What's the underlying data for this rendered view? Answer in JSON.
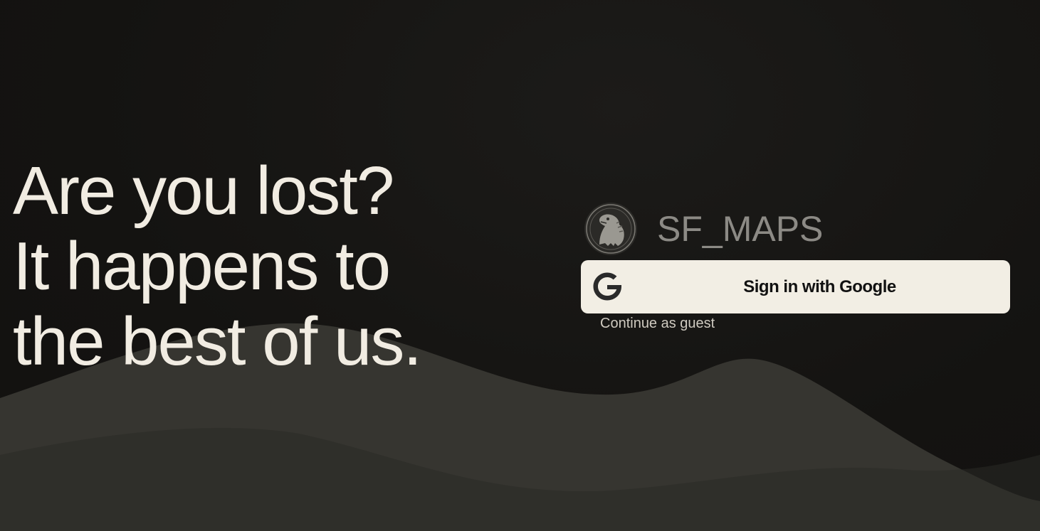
{
  "headline": {
    "line1": "Are you lost?",
    "line2": "It happens to",
    "line3": "the best of us."
  },
  "brand": {
    "name": "SF_MAPS",
    "logo_icon": "dinosaur-seal-logo"
  },
  "auth": {
    "google_button_label": "Sign in with Google",
    "google_icon": "google-g-icon",
    "guest_link_label": "Continue as guest"
  },
  "colors": {
    "background": "#141311",
    "wave": "#363530",
    "headline_text": "#f1ece2",
    "button_bg": "#f2eee4",
    "brand_text": "#8c8a85"
  }
}
